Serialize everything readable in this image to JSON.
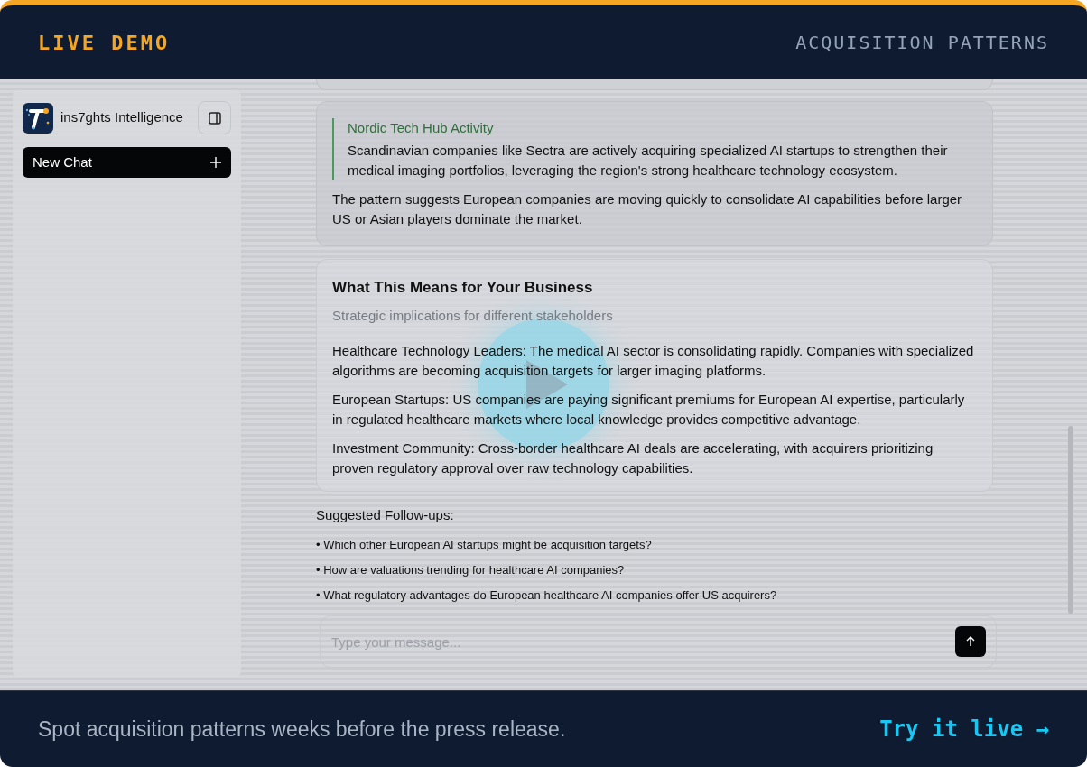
{
  "header": {
    "badge": "LIVE DEMO",
    "title": "ACQUISITION PATTERNS"
  },
  "sidebar": {
    "brand": "ins7ghts Intelligence",
    "new_chat": "New Chat"
  },
  "messages": [
    {
      "kind": "quote",
      "quote_title": "Nordic Tech Hub Activity",
      "quote_text": "Scandinavian companies like Sectra are actively acquiring specialized AI startups to strengthen their medical imaging portfolios, leveraging the region's strong healthcare technology ecosystem.",
      "paragraphs": [
        "The pattern suggests European companies are moving quickly to consolidate AI capabilities before larger US or Asian players dominate the market."
      ]
    },
    {
      "kind": "section",
      "title": "What This Means for Your Business",
      "subtitle": "Strategic implications for different stakeholders",
      "paragraphs": [
        "Healthcare Technology Leaders: The medical AI sector is consolidating rapidly. Companies with specialized algorithms are becoming acquisition targets for larger imaging platforms.",
        "European Startups: US companies are paying significant premiums for European AI expertise, particularly in regulated healthcare markets where local knowledge provides competitive advantage.",
        "Investment Community: Cross-border healthcare AI deals are accelerating, with acquirers prioritizing proven regulatory approval over raw technology capabilities."
      ]
    }
  ],
  "followups": {
    "heading": "Suggested Follow-ups:",
    "items": [
      "• Which other European AI startups might be acquisition targets?",
      "• How are valuations trending for healthcare AI companies?",
      "• What regulatory advantages do European healthcare AI companies offer US acquirers?"
    ]
  },
  "composer": {
    "placeholder": "Type your message..."
  },
  "footer": {
    "tagline": "Spot acquisition patterns weeks before the press release.",
    "cta": "Try it live →"
  }
}
